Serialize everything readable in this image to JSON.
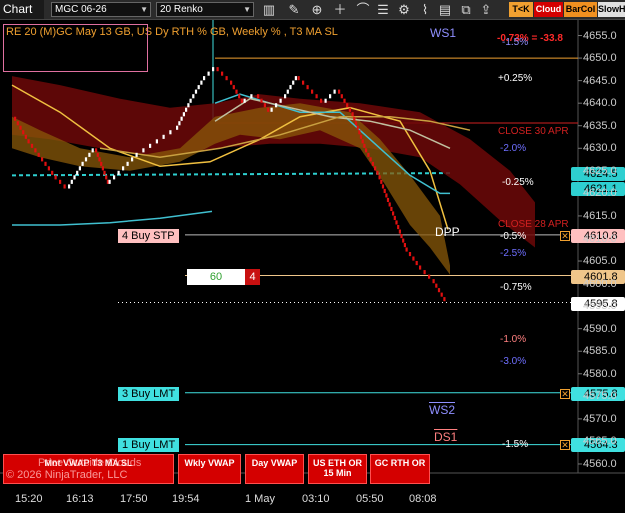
{
  "toolbar": {
    "title": "Chart",
    "instrument": "MGC 06-26",
    "bar_type": "20 Renko",
    "pills": [
      "T<K",
      "Cloud",
      "BarCol",
      "SlowH"
    ]
  },
  "header": {
    "text": "RE 20  (M)GC May 13 GB, US Dy RTH % GB, Weekly % , T3 MA SL",
    "pct_change": "-0.73% = -33.8"
  },
  "chart_data": {
    "type": "line",
    "title": "RE 20  (M)GC May 13 GB, US Dy RTH % GB, Weekly % , T3 MA SL",
    "x_tick_labels": [
      "15:20",
      "16:13",
      "17:50",
      "19:54",
      "1 May",
      "03:10",
      "05:50",
      "08:08"
    ],
    "y_tick_labels": [
      "4655.0",
      "4650.0",
      "4645.0",
      "4640.0",
      "4635.0",
      "4630.0",
      "4625.0",
      "4620.0",
      "4615.0",
      "4610.0",
      "4605.0",
      "4600.0",
      "4595.0",
      "4590.0",
      "4585.0",
      "4580.0",
      "4575.0",
      "4570.0",
      "4565.0",
      "4560.0"
    ],
    "ylim": [
      4558,
      4658
    ],
    "series": [
      {
        "values": [
          4637,
          4632,
          4628,
          4624,
          4621,
          4626,
          4630,
          4622,
          4625,
          4628,
          4630,
          4632,
          4634,
          4640,
          4645,
          4648,
          4645,
          4640,
          4642,
          4638,
          4641,
          4646,
          4643,
          4640,
          4643,
          4638,
          4630,
          4624,
          4616,
          4608,
          4604,
          4601,
          4596
        ]
      }
    ],
    "price_markers": [
      {
        "label": "4624.5",
        "color": "#2ecfd0"
      },
      {
        "label": "4621.1",
        "color": "#2ecfd0"
      },
      {
        "label": "4610.8",
        "color": "#ffc0c0"
      },
      {
        "label": "4601.8",
        "color": "#f0c68a"
      },
      {
        "label": "4595.8",
        "color": "#ffffff"
      },
      {
        "label": "4575.8",
        "color": "#40e0e0"
      },
      {
        "label": "4564.3",
        "color": "#40e0e0"
      }
    ],
    "level_labels": [
      {
        "text": "WS1",
        "color": "#8f8fff"
      },
      {
        "text": "-1.5%",
        "color": "#8f8fff"
      },
      {
        "text": "+0.25%",
        "color": "#ffffff"
      },
      {
        "text": "CLOSE 30 APR",
        "color": "#d02020"
      },
      {
        "text": "-2.0%",
        "color": "#6f6fff"
      },
      {
        "text": "-0.25%",
        "color": "#ffffff"
      },
      {
        "text": "CLOSE 28 APR",
        "color": "#d02020"
      },
      {
        "text": "DPP",
        "color": "#ffffff"
      },
      {
        "text": "-0.5%",
        "color": "#ffffff"
      },
      {
        "text": "-2.5%",
        "color": "#6f6fff"
      },
      {
        "text": "-0.75%",
        "color": "#ffffff"
      },
      {
        "text": "-1.0%",
        "color": "#ff8080"
      },
      {
        "text": "-3.0%",
        "color": "#6f6fff"
      },
      {
        "text": "WS2",
        "color": "#8f8fff"
      },
      {
        "text": "DS1",
        "color": "#ff8080"
      },
      {
        "text": "-1.5%",
        "color": "#ffffff"
      }
    ]
  },
  "orders": [
    {
      "label": "4 Buy STP",
      "color": "#ffc0c0"
    },
    {
      "label": "3 Buy LMT",
      "color": "#40e0e0"
    },
    {
      "label": "1 Buy LMT",
      "color": "#40e0e0"
    }
  ],
  "position": {
    "qty": "60",
    "count": "4"
  },
  "bottom_buttons": [
    {
      "label": "Mnt VWAP T3 MA SL"
    },
    {
      "label": "Wkly VWAP"
    },
    {
      "label": "Day VWAP"
    },
    {
      "label": "US ETH OR 15 Min"
    },
    {
      "label": "GC RTH OR"
    }
  ],
  "overlay_text": {
    "line1": "Price Outside Clouds",
    "line2": "© 2026 NinjaTrader, LLC"
  },
  "colors": {
    "background": "#000000",
    "up_brick": "#ffffff",
    "down_brick": "#e01010",
    "cloud": "#7a0a0a",
    "accent": "#f0a030"
  }
}
